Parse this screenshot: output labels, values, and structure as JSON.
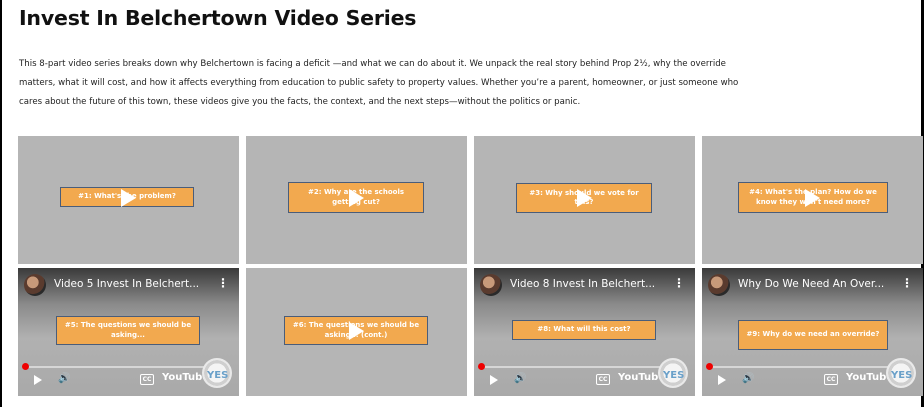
{
  "page": {
    "title": "Invest In Belchertown Video Series",
    "intro_lines": [
      "This 8-part video series breaks down why Belchertown is facing a deficit —and what we can do about it. We unpack the real story behind Prop 2½, why the override",
      "matters, what it will cost, and how it affects everything from education to public safety to property values. Whether you’re a parent, homeowner, or just someone who",
      "cares about the future of this town, these videos give you the facts, the context, and the next steps—without the politics or panic."
    ]
  },
  "videos": [
    {
      "overlay": "#1: What's the problem?"
    },
    {
      "overlay": "#2: Why are the schools getting cut?"
    },
    {
      "overlay": "#3: Why should we vote for this?"
    },
    {
      "overlay": "#4: What's the plan? How do we know they won't need more?"
    },
    {
      "overlay": "#5: The questions we should be asking...",
      "yt_title": "Video 5 Invest In Belchert...",
      "menu": "⋮",
      "cc": "CC",
      "yt_logo": "YouTube",
      "seal": "YES"
    },
    {
      "overlay": "#6: The questions we should be asking... (cont.)"
    },
    {
      "overlay": "#8: What will this cost?",
      "yt_title": "Video 8 Invest In Belchert...",
      "menu": "⋮",
      "cc": "CC",
      "yt_logo": "YouTube",
      "seal": "YES"
    },
    {
      "overlay": "#9: Why do we need an override?",
      "yt_title": "Why Do We Need An Over...",
      "menu": "⋮",
      "cc": "CC",
      "yt_logo": "YouTube",
      "seal": "YES"
    }
  ],
  "icons": {
    "play": "play-icon",
    "volume": "volume-icon"
  },
  "colors": {
    "overlay_bg": "#f2a94f",
    "overlay_border": "#4a5d7a",
    "tile_bg": "#b5b5b5",
    "progress": "#e00000"
  }
}
